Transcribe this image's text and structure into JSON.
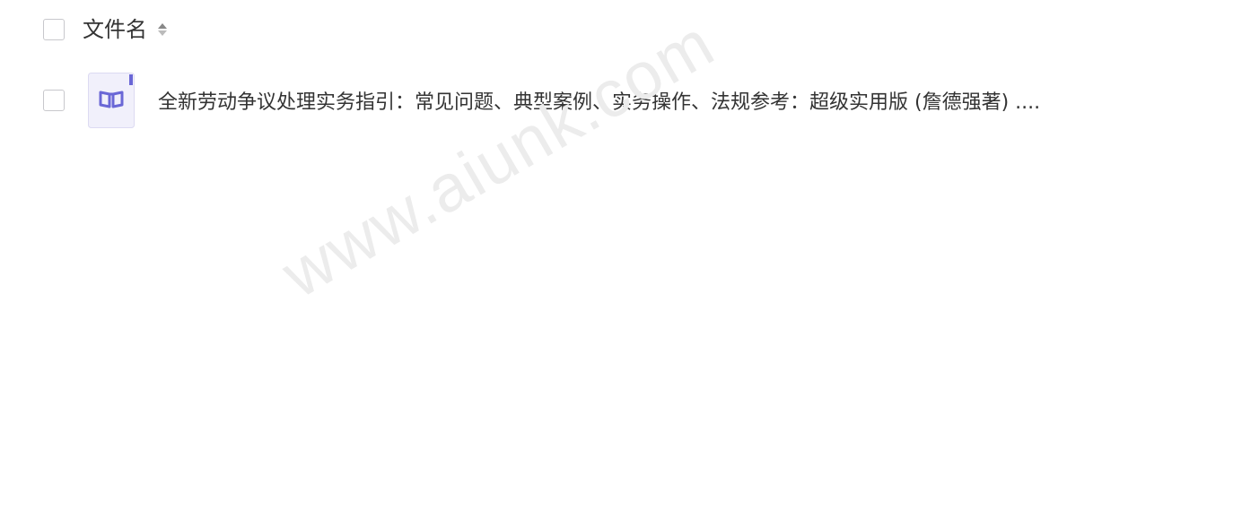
{
  "header": {
    "column_label": "文件名",
    "select_all_icon": "checkbox-icon",
    "sort_icon": "sort-caret-icon"
  },
  "files": [
    {
      "name": "全新劳动争议处理实务指引：常见问题、典型案例、实务操作、法规参考：超级实用版 (詹德强著) ....",
      "icon": "book-file-icon"
    }
  ],
  "watermark": {
    "text": "www.aiunk.com"
  },
  "colors": {
    "icon_accent": "#6a67d6",
    "icon_bg": "#f1f0fb",
    "checkbox_border": "#c8c8cc",
    "text": "#333333",
    "watermark": "#ececec"
  }
}
